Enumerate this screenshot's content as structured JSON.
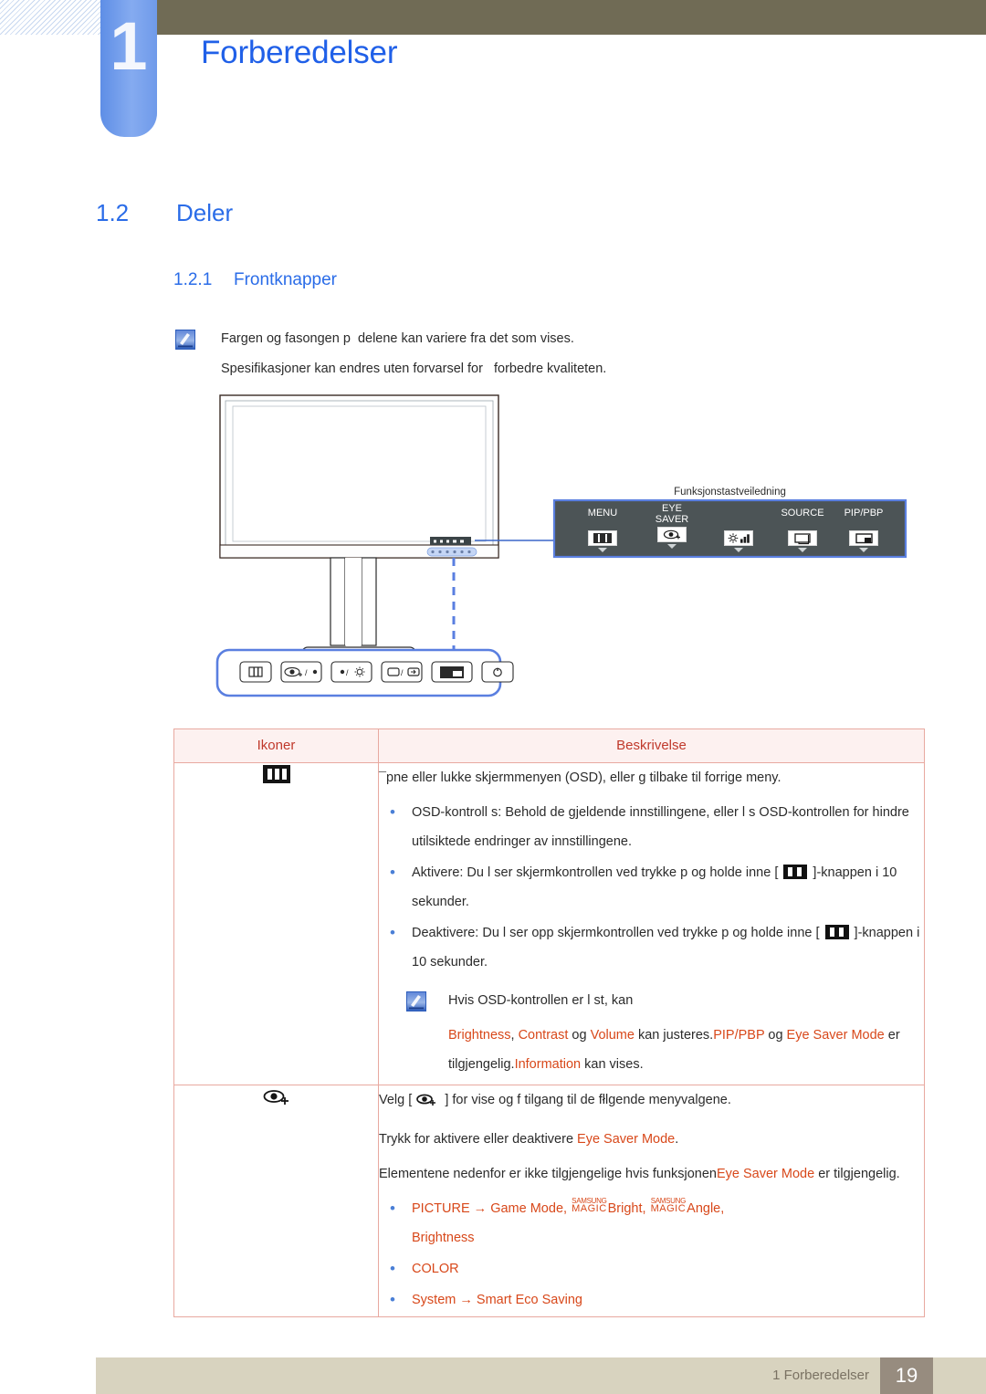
{
  "header": {
    "chapter_number": "1",
    "chapter_title": "Forberedelser"
  },
  "headings": {
    "h2_number": "1.2",
    "h2_title": "Deler",
    "h3_number": "1.2.1",
    "h3_title": "Frontknapper"
  },
  "intro_note": {
    "icon": "note-icon",
    "line1": "Fargen og fasongen p  delene kan variere fra det som vises.",
    "line2": "Spesifikasjoner kan endres uten forvarsel for   forbedre kvaliteten."
  },
  "diagram": {
    "guide_caption": "Funksjonstastveiledning",
    "function_keys": [
      {
        "label_line1": "MENU",
        "label_line2": "",
        "icon": "menu-icon"
      },
      {
        "label_line1": "EYE",
        "label_line2": "SAVER",
        "icon": "eye-saver-icon"
      },
      {
        "label_line1": "",
        "label_line2": "",
        "icon": "brightness-volume-icon"
      },
      {
        "label_line1": "SOURCE",
        "label_line2": "",
        "icon": "source-icon"
      },
      {
        "label_line1": "PIP/PBP",
        "label_line2": "",
        "icon": "pip-pbp-icon"
      }
    ],
    "front_buttons": [
      "menu-button-icon",
      "eye-saver-button-icon",
      "brightness-button-icon",
      "source-button-icon",
      "pip-pbp-button-icon",
      "power-button-icon"
    ]
  },
  "table": {
    "headers": [
      "Ikoner",
      "Beskrivelse"
    ],
    "rows": [
      {
        "icon": "menu-key-icon",
        "intro": "¯pne eller lukke skjermmenyen (OSD), eller g  tilbake til forrige meny.",
        "bullets": [
          "OSD-kontroll s: Behold de gjeldende innstillingene, eller l s OSD-kontrollen for   hindre utilsiktede endringer av innstillingene.",
          "Aktivere: Du l ser skjermkontrollen ved   trykke p  og holde inne [ @KEY ]-knappen i 10 sekunder.",
          "Deaktivere: Du l ser opp skjermkontrollen ved   trykke p  og holde inne [ @KEY ]-knappen i 10 sekunder."
        ],
        "note": {
          "line1": "Hvis OSD-kontrollen er l st, kan",
          "line2_parts": [
            {
              "text": "Brightness",
              "color": "orange"
            },
            {
              "text": ", ",
              "color": "normal"
            },
            {
              "text": "Contrast",
              "color": "orange"
            },
            {
              "text": " og ",
              "color": "normal"
            },
            {
              "text": "Volume",
              "color": "orange"
            },
            {
              "text": " kan justeres.",
              "color": "normal"
            },
            {
              "text": "PIP/PBP",
              "color": "orange"
            },
            {
              "text": " og ",
              "color": "normal"
            },
            {
              "text": "Eye Saver Mode",
              "color": "orange"
            },
            {
              "text": " er tilgjengelig.",
              "color": "normal"
            },
            {
              "text": "Information",
              "color": "orange"
            },
            {
              "text": " kan vises.",
              "color": "normal"
            }
          ]
        }
      },
      {
        "icon": "eye-saver-key-icon",
        "line1_pre": "Velg [",
        "line1_post": "] for   vise og f  tilgang til de fłlgende menyvalgene.",
        "line2_pre": "Trykk for   aktivere eller deaktivere ",
        "line2_em": "Eye Saver Mode",
        "line2_post": ".",
        "line3_pre": "Elementene nedenfor er ikke tilgjengelige hvis funksjonen",
        "line3_em": "Eye Saver Mode",
        "line3_post": " er tilgjengelig.",
        "bullets": [
          {
            "parts": [
              "PICTURE",
              " → ",
              "Game Mode",
              ", ",
              "@MAGIC",
              "Bright",
              ", ",
              "@MAGIC",
              "Angle",
              ",",
              "Brightness"
            ]
          },
          {
            "text": "COLOR"
          },
          {
            "text": "System → Smart Eco Saving"
          }
        ]
      }
    ]
  },
  "footer": {
    "text": "1 Forberedelser",
    "page": "19"
  },
  "colors": {
    "heading_blue": "#2a6ce8",
    "olive_bar": "#706b55",
    "tab_blue": "#6f9aea",
    "table_border": "#e8a9a0",
    "table_header_bg": "#fdf1f0",
    "table_header_text": "#c0392b",
    "orange_term": "#d8481a",
    "bullet_blue": "#4a7fd6",
    "footer_bg": "#d8d3bf",
    "footer_page_bg": "#978c7f",
    "panel_dark": "#4c5456"
  }
}
